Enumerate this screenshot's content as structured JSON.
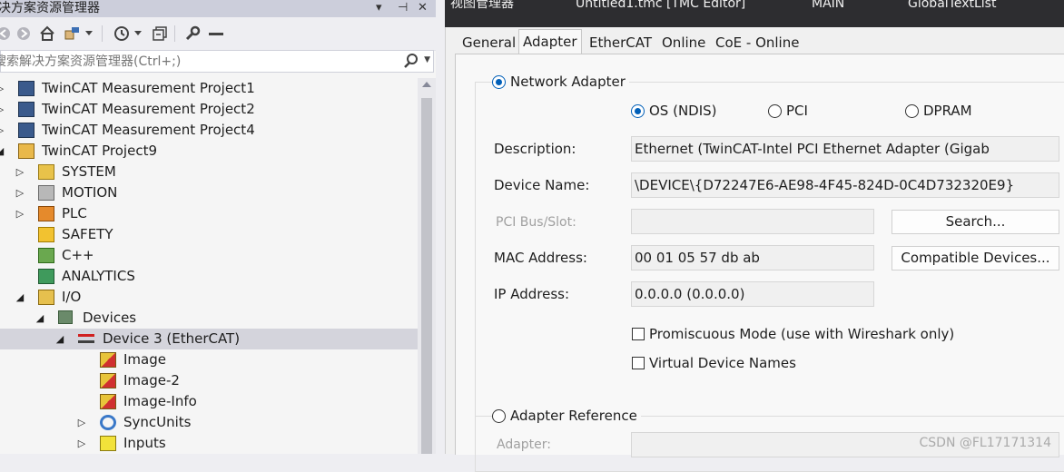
{
  "left": {
    "title": "决方案资源管理器",
    "title_controls": [
      "▾",
      "⊣",
      "✕"
    ],
    "search_placeholder": "搜索解决方案资源管理器(Ctrl+;)"
  },
  "tree": [
    {
      "label": "TwinCAT Measurement Project1",
      "icon": "measurement-project-icon",
      "expander": "▷"
    },
    {
      "label": "TwinCAT Measurement Project2",
      "icon": "measurement-project-icon",
      "expander": "▷"
    },
    {
      "label": "TwinCAT Measurement Project4",
      "icon": "measurement-project-icon",
      "expander": "▷"
    },
    {
      "label": "TwinCAT Project9",
      "icon": "twincat-project-icon",
      "expander": "◢"
    },
    {
      "label": "SYSTEM",
      "icon": "system-icon",
      "expander": "▷"
    },
    {
      "label": "MOTION",
      "icon": "motion-icon",
      "expander": "▷"
    },
    {
      "label": "PLC",
      "icon": "plc-icon",
      "expander": "▷"
    },
    {
      "label": "SAFETY",
      "icon": "safety-icon",
      "expander": ""
    },
    {
      "label": "C++",
      "icon": "cpp-icon",
      "expander": ""
    },
    {
      "label": "ANALYTICS",
      "icon": "analytics-icon",
      "expander": ""
    },
    {
      "label": "I/O",
      "icon": "io-icon",
      "expander": "◢"
    },
    {
      "label": "Devices",
      "icon": "devices-icon",
      "expander": "◢"
    },
    {
      "label": "Device 3 (EtherCAT)",
      "icon": "ethercat-device-icon",
      "expander": "◢"
    },
    {
      "label": "Image",
      "icon": "image-icon",
      "expander": ""
    },
    {
      "label": "Image-2",
      "icon": "image-icon",
      "expander": ""
    },
    {
      "label": "Image-Info",
      "icon": "image-icon",
      "expander": ""
    },
    {
      "label": "SyncUnits",
      "icon": "syncunits-icon",
      "expander": "▷"
    },
    {
      "label": "Inputs",
      "icon": "inputs-icon",
      "expander": "▷"
    }
  ],
  "doc_tabs": [
    "视图管理器",
    "Untitled1.tmc [TMC Editor]",
    "MAIN",
    "GlobalTextList"
  ],
  "tabs": [
    "General",
    "Adapter",
    "EtherCAT",
    "Online",
    "CoE - Online"
  ],
  "adapter": {
    "network_adapter": "Network Adapter",
    "os_ndis": "OS (NDIS)",
    "pci": "PCI",
    "dpram": "DPRAM",
    "description_label": "Description:",
    "description_value": "Ethernet (TwinCAT-Intel PCI Ethernet Adapter (Gigab",
    "device_name_label": "Device Name:",
    "device_name_value": "\\DEVICE\\{D72247E6-AE98-4F45-824D-0C4D732320E9}",
    "pci_bus_label": "PCI Bus/Slot:",
    "search_button": "Search...",
    "mac_label": "MAC Address:",
    "mac_value": "00 01 05 57 db ab",
    "compatible_button": "Compatible Devices...",
    "ip_label": "IP Address:",
    "ip_value": "0.0.0.0 (0.0.0.0)",
    "promiscuous": "Promiscuous Mode (use with Wireshark only)",
    "virtual_names": "Virtual Device Names",
    "adapter_reference": "Adapter Reference",
    "adapter_label": "Adapter:"
  },
  "watermark": "CSDN @FL17171314"
}
